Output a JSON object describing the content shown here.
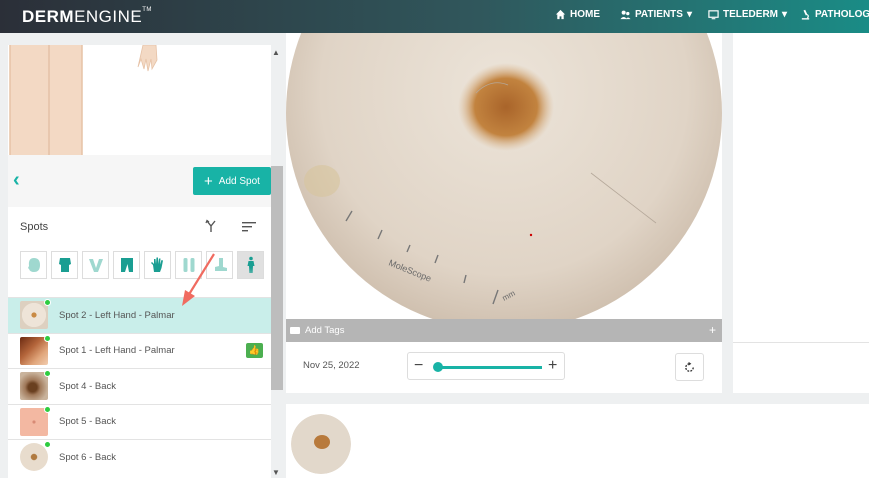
{
  "header": {
    "logo_bold": "DERM",
    "logo_thin": "ENGINE",
    "logo_tm": "TM",
    "nav": [
      {
        "label": "HOME",
        "icon": "home-icon"
      },
      {
        "label": "PATIENTS",
        "icon": "patients-icon"
      },
      {
        "label": "TELEDERM",
        "icon": "telederm-icon"
      },
      {
        "label": "PATHOLOG",
        "icon": "microscope-icon"
      }
    ]
  },
  "actions": {
    "back_icon": "chevron-left-icon",
    "add_spot_label": "Add Spot"
  },
  "spots": {
    "title": "Spots",
    "filters": [
      "head",
      "torso",
      "neck",
      "legs",
      "hand",
      "lower-legs",
      "foot",
      "full-body"
    ],
    "active_filter": "full-body",
    "items": [
      {
        "label": "Spot 2 - Left Hand - Palmar",
        "selected": true,
        "approved": false
      },
      {
        "label": "Spot 1 - Left Hand - Palmar",
        "selected": false,
        "approved": true
      },
      {
        "label": "Spot 4 - Back",
        "selected": false,
        "approved": false
      },
      {
        "label": "Spot 5 - Back",
        "selected": false,
        "approved": false
      },
      {
        "label": "Spot 6 - Back",
        "selected": false,
        "approved": false
      }
    ]
  },
  "viewer": {
    "add_tags_label": "Add Tags",
    "tags_plus": "+",
    "date": "Nov 25, 2022",
    "watermark": "MoleScope",
    "unit": "mm",
    "zoom_minus": "−",
    "zoom_plus": "+",
    "zoom_level": 0.0
  },
  "colors": {
    "accent": "#18b3a6",
    "selected_row": "#c9eeea",
    "status_dot": "#2ecc40",
    "approved": "#4caf50"
  }
}
